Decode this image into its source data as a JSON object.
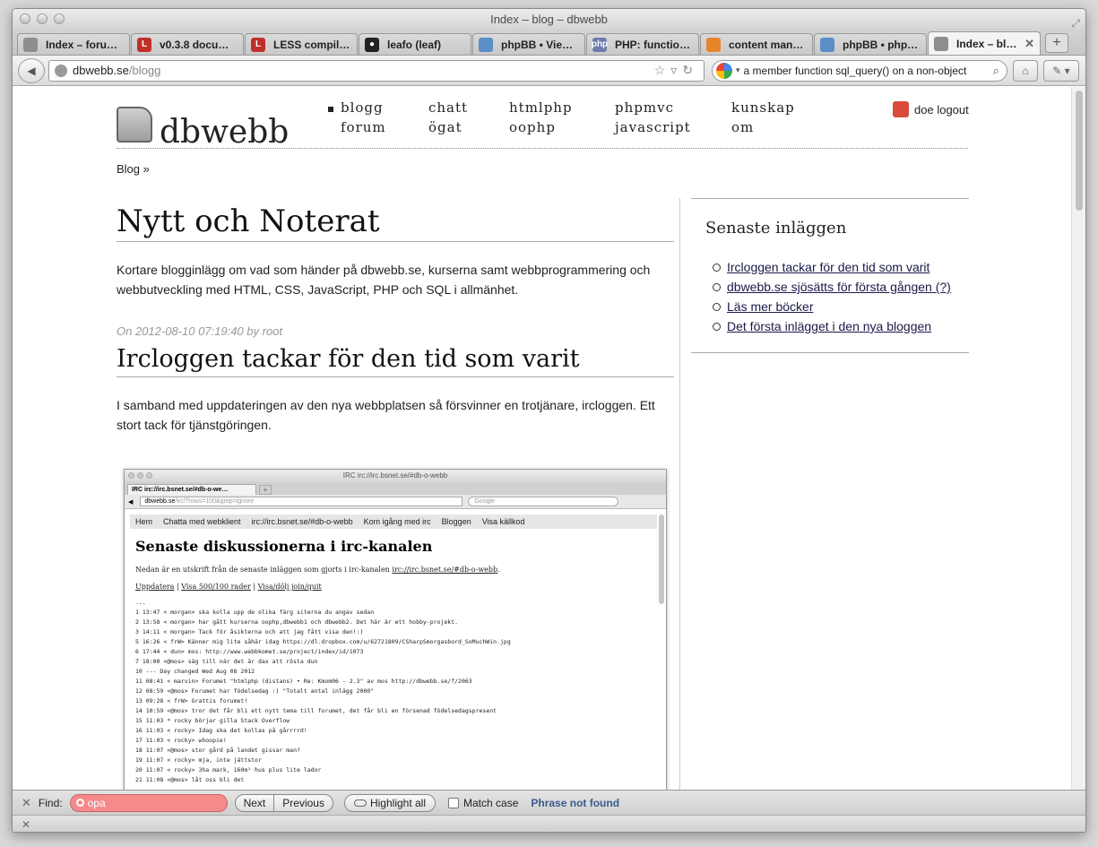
{
  "window": {
    "title": "Index – blog – dbwebb"
  },
  "tabs": [
    {
      "label": "Index – foru…",
      "fav_color": "#8e8e8e",
      "fav_glyph": ""
    },
    {
      "label": "v0.3.8 docum…",
      "fav_color": "#c0302b",
      "fav_glyph": "L"
    },
    {
      "label": "LESS compile…",
      "fav_color": "#c0302b",
      "fav_glyph": "L"
    },
    {
      "label": "leafo (leaf)",
      "fav_color": "#222222",
      "fav_glyph": "●"
    },
    {
      "label": "phpBB • Vie…",
      "fav_color": "#5c8fc6",
      "fav_glyph": ""
    },
    {
      "label": "PHP: function…",
      "fav_color": "#6f7bab",
      "fav_glyph": "php"
    },
    {
      "label": "content man…",
      "fav_color": "#e8852b",
      "fav_glyph": ""
    },
    {
      "label": "phpBB • php…",
      "fav_color": "#5c8fc6",
      "fav_glyph": ""
    },
    {
      "label": "Index – bl…",
      "fav_color": "#8e8e8e",
      "fav_glyph": "",
      "active": true
    }
  ],
  "navbar": {
    "url_host": "dbwebb.se",
    "url_path": "/blogg",
    "search_value": "a member function sql_query() on a non-object"
  },
  "site": {
    "logo_text": "dbwebb",
    "nav": [
      "blogg",
      "chatt",
      "htmlphp",
      "phpmvc",
      "kunskap",
      "forum",
      "ögat",
      "oophp",
      "javascript",
      "om"
    ],
    "user": "doe",
    "logout": "logout",
    "breadcrumb": "Blog »"
  },
  "main": {
    "title": "Nytt och Noterat",
    "intro": "Kortare blogginlägg om vad som händer på dbwebb.se, kurserna samt webbprogrammering och webbutveckling med HTML, CSS, JavaScript, PHP och SQL i allmänhet.",
    "post_meta": "On 2012-08-10 07:19:40 by root",
    "post_title": "Ircloggen tackar för den tid som varit",
    "post_body": "I samband med uppdateringen av den nya webbplatsen så försvinner en trotjänare, ircloggen. Ett stort tack för tjänstgöringen."
  },
  "sidebar": {
    "title": "Senaste inläggen",
    "links": [
      "Ircloggen tackar för den tid som varit",
      "dbwebb.se sjösätts för första gången (?)",
      "Läs mer böcker",
      "Det första inlägget i den nya bloggen"
    ]
  },
  "screenshot": {
    "window_title": "IRC irc://irc.bsnet.se/#db-o-webb",
    "tab_label": "IRC irc://irc.bsnet.se/#db-o-we…",
    "url_host": "dbwebb.se",
    "url_path": "/irc/?rows=100&grep=ignore",
    "search_placeholder": "Google",
    "menu": [
      "Hem",
      "Chatta med webklient",
      "irc://irc.bsnet.se/#db-o-webb",
      "Kom igång med irc",
      "Bloggen",
      "Visa källkod"
    ],
    "heading": "Senaste diskussionerna i irc-kanalen",
    "desc_prefix": "Nedan är en utskrift från de senaste inläggen som gjorts i irc-kanalen ",
    "desc_link": "irc://irc.bsnet.se/#db-o-webb",
    "link_update": "Uppdatera",
    "link_show": "Visa 500/100 rader",
    "link_join": "Visa/dölj join/quit",
    "log": "...\n1 13:47 < morgan> ska kolla upp de olika färg siterna du angav sedan\n2 13:58 < morgan> har gått kurserna oophp,dbwebb1 och dbwebb2. Det här är ett hobby-projekt.\n3 14:11 < morgan> Tack för åsikterna och att jag fått visa den!:)\n5 16:26 < frW> Känner mig lite såhär idag https://dl.dropbox.com/u/62721809/CSharpSmorgasbord_SoMuchWin.jpg\n6 17:44 < dun> mos: http://www.webbkomet.se/project/index/id/1073\n7 18:00 <@mos> säg till när det är dax att rösta dun\n10 --- Day changed Wed Aug 08 2012\n11 08:41 < marvin> Forumet \"htmlphp (distans) • Re: Kmom06 - 2.3\" av mos http://dbwebb.se/f/2063\n12 08:59 <@mos> Forumet har födelsedag :) \"Totalt antal inlägg 2000\"\n13 09:28 < frW> Grattis forumet!\n14 10:59 <@mos> tror det får bli ett nytt tema till forumet, det får bli en försenad födelsedagspresent\n15 11:03 * rocky börjar gilla Stack Overflow\n16 11:03 < rocky> Idag ska det kollas på gårrrrd!\n17 11:03 < rocky> whoopie!\n18 11:07 <@mos> stor gård på landet gissar man?\n19 11:07 < rocky> mja, inte jättstor\n20 11:07 < rocky> 3ha mark, 160m² hus plus lite lador\n21 11:08 <@mos> låt oss bli det"
  },
  "findbar": {
    "label": "Find:",
    "value": "opa",
    "next": "Next",
    "previous": "Previous",
    "highlight": "Highlight all",
    "match_case": "Match case",
    "status": "Phrase not found"
  }
}
